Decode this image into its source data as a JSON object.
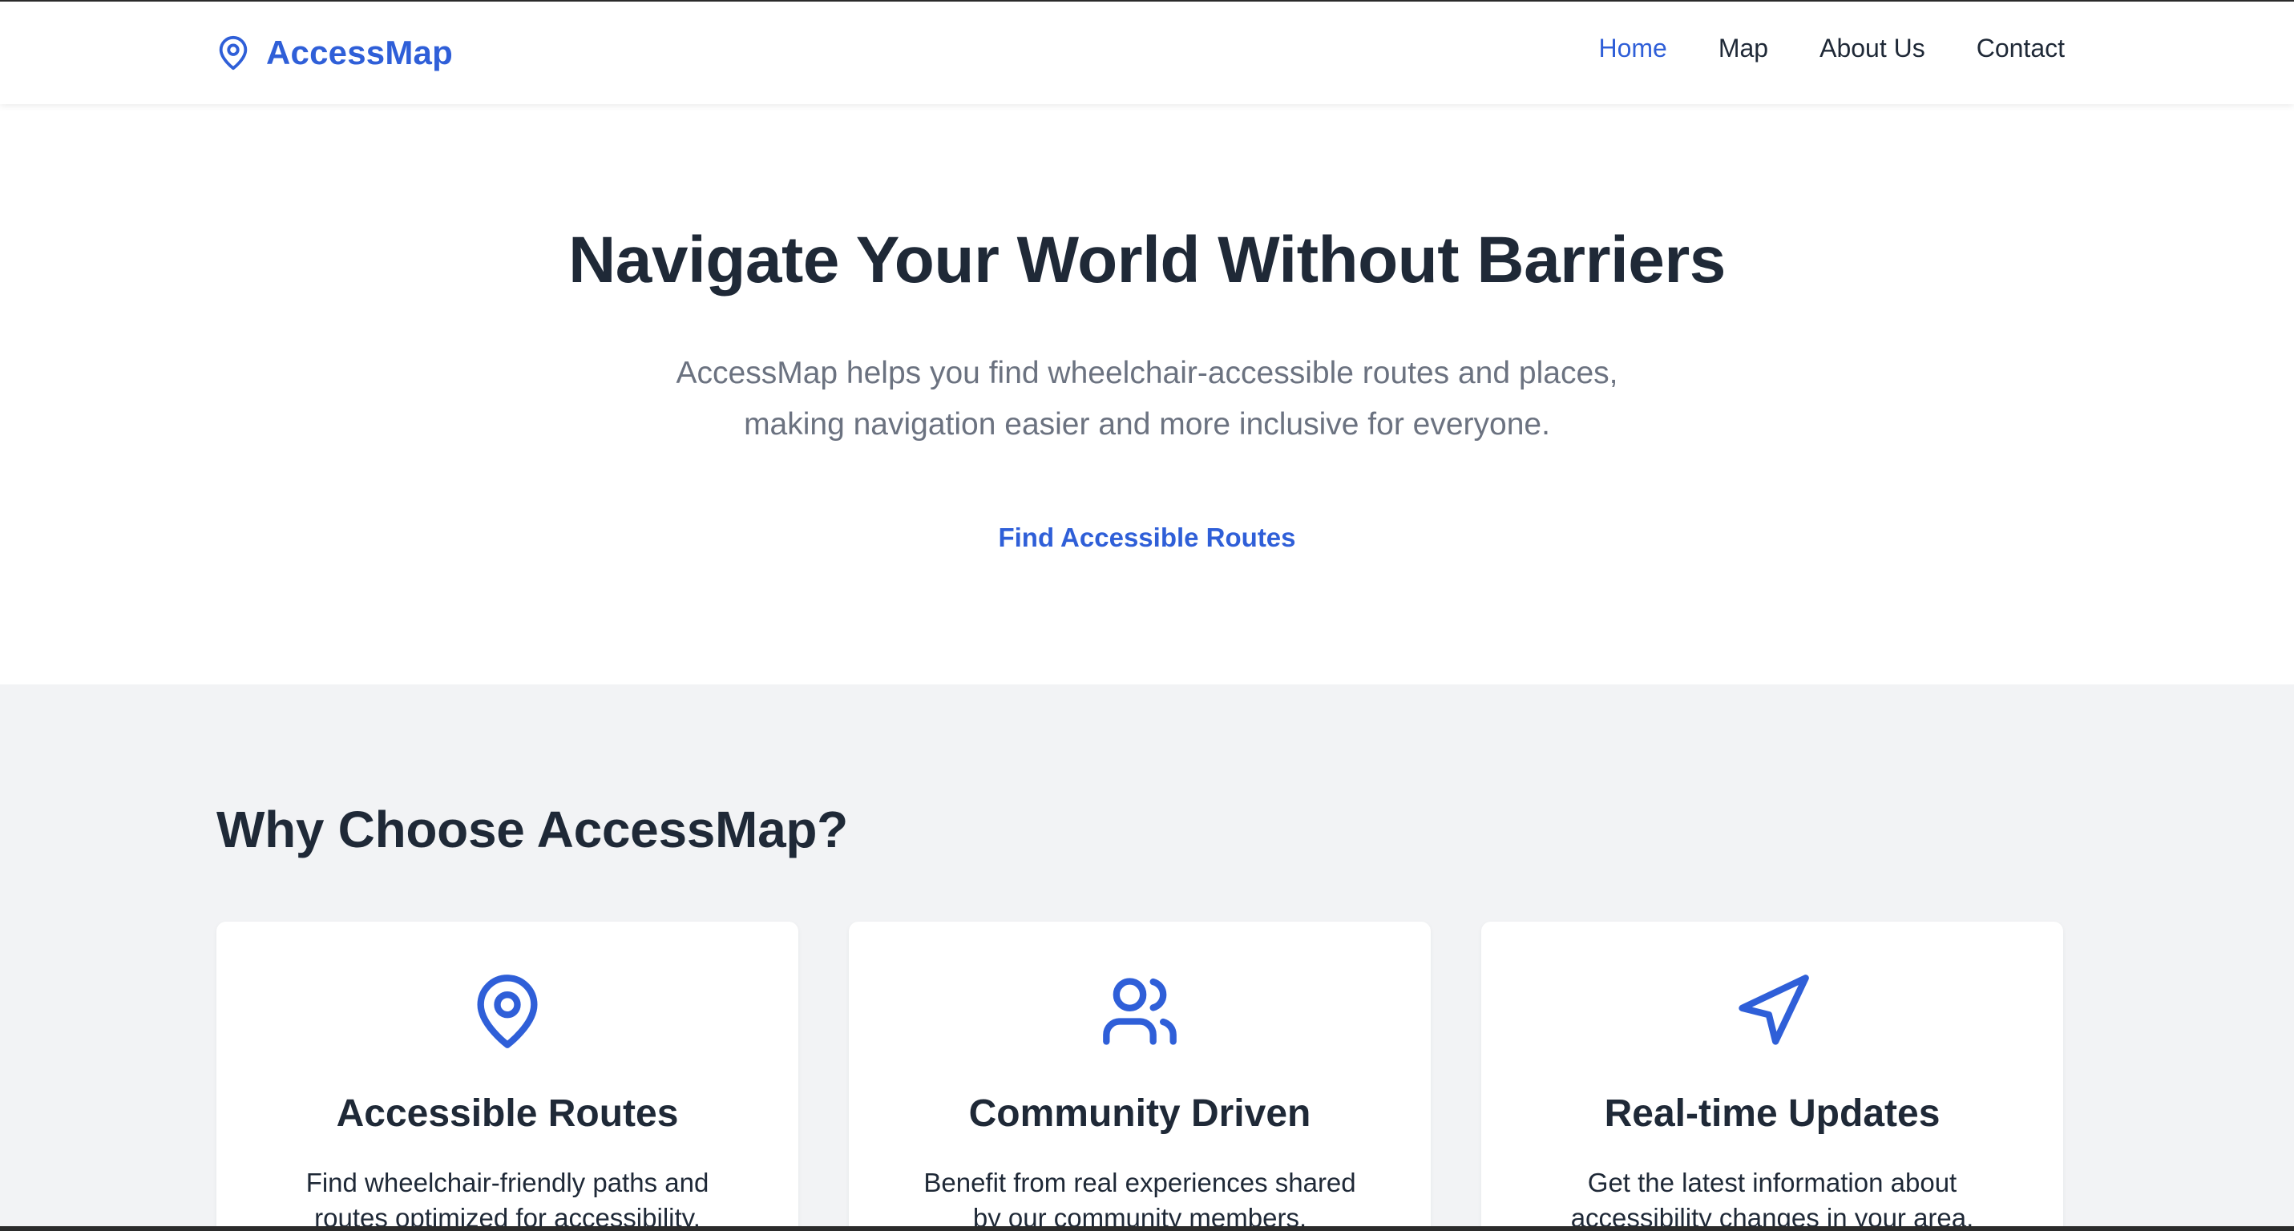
{
  "header": {
    "brand": "AccessMap",
    "brand_icon": "map-pin-icon",
    "nav": [
      {
        "label": "Home",
        "active": true
      },
      {
        "label": "Map",
        "active": false
      },
      {
        "label": "About Us",
        "active": false
      },
      {
        "label": "Contact",
        "active": false
      }
    ]
  },
  "hero": {
    "title": "Navigate Your World Without Barriers",
    "subtitle": "AccessMap helps you find wheelchair-accessible routes and places, making navigation easier and more inclusive for everyone.",
    "cta": "Find Accessible Routes"
  },
  "features": {
    "title": "Why Choose AccessMap?",
    "cards": [
      {
        "icon": "map-pin-icon",
        "title": "Accessible Routes",
        "text": "Find wheelchair-friendly paths and routes optimized for accessibility."
      },
      {
        "icon": "users-icon",
        "title": "Community Driven",
        "text": "Benefit from real experiences shared by our community members."
      },
      {
        "icon": "navigation-arrow-icon",
        "title": "Real-time Updates",
        "text": "Get the latest information about accessibility changes in your area."
      }
    ]
  },
  "colors": {
    "accent": "#2f5fd8",
    "text": "#1f2937",
    "muted": "#6b7280",
    "section_bg": "#f2f3f5"
  }
}
